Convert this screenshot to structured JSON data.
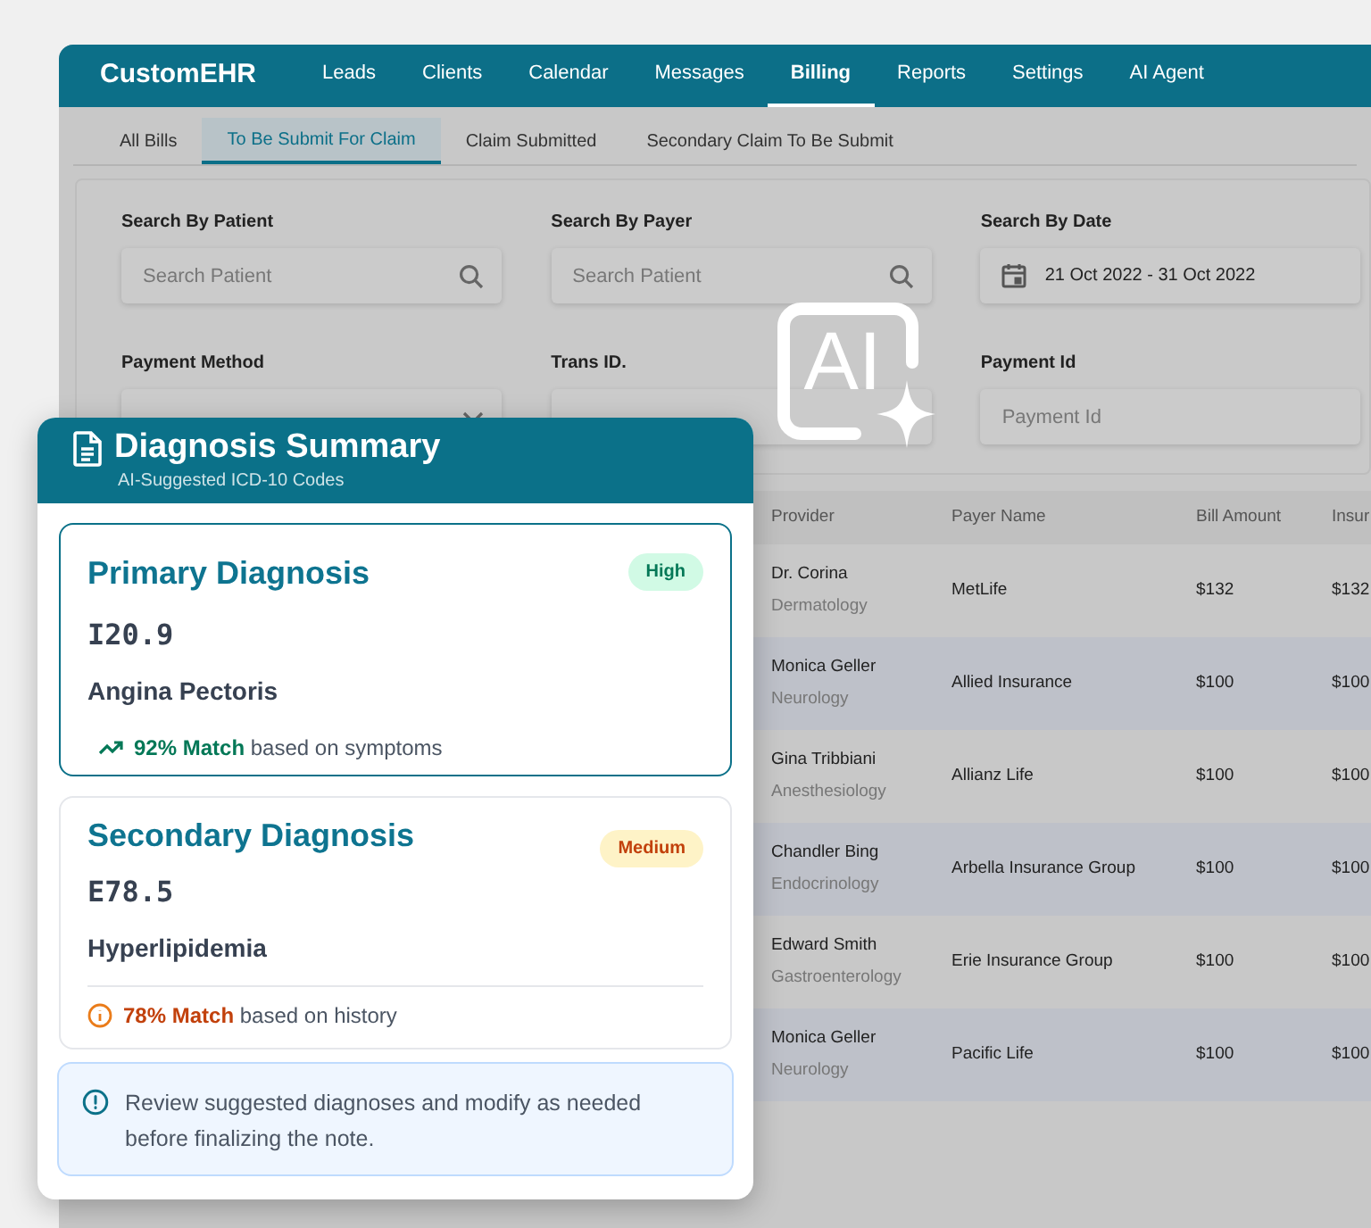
{
  "nav": {
    "brand": "CustomEHR",
    "items": [
      {
        "label": "Leads",
        "selected": false
      },
      {
        "label": "Clients",
        "selected": false
      },
      {
        "label": "Calendar",
        "selected": false
      },
      {
        "label": "Messages",
        "selected": false
      },
      {
        "label": "Billing",
        "selected": true
      },
      {
        "label": "Reports",
        "selected": false
      },
      {
        "label": "Settings",
        "selected": false
      },
      {
        "label": "AI Agent",
        "selected": false
      }
    ]
  },
  "subtabs": [
    {
      "label": "All Bills",
      "selected": false
    },
    {
      "label": "To Be Submit For Claim",
      "selected": true
    },
    {
      "label": "Claim Submitted",
      "selected": false
    },
    {
      "label": "Secondary Claim To Be Submit",
      "selected": false
    }
  ],
  "filters": [
    {
      "label": "Search By Patient",
      "kind": "search",
      "placeholder": "Search Patient"
    },
    {
      "label": "Search By Payer",
      "kind": "search",
      "placeholder": "Search Patient"
    },
    {
      "label": "Search By Date",
      "kind": "date",
      "value": "21 Oct 2022 - 31 Oct 2022"
    },
    {
      "label": "Payment Method",
      "kind": "select"
    },
    {
      "label": "Trans ID.",
      "kind": "text"
    },
    {
      "label": "Payment Id",
      "kind": "text",
      "placeholder": "Payment Id"
    }
  ],
  "ai_badge": {
    "label": "AI"
  },
  "table": {
    "columns": [
      "Provider",
      "Payer Name",
      "Bill Amount",
      "Insur"
    ],
    "rows": [
      {
        "provider": "Dr. Corina",
        "specialty": "Dermatology",
        "payer": "MetLife",
        "bill": "$132",
        "column_4": "$132"
      },
      {
        "provider": "Monica Geller",
        "specialty": "Neurology",
        "payer": "Allied Insurance",
        "bill": "$100",
        "column_4": "$100"
      },
      {
        "provider": "Gina Tribbiani",
        "specialty": "Anesthesiology",
        "payer": "Allianz Life",
        "bill": "$100",
        "column_4": "$100"
      },
      {
        "provider": "Chandler Bing",
        "specialty": "Endocrinology",
        "payer": "Arbella Insurance Group",
        "bill": "$100",
        "column_4": "$100"
      },
      {
        "provider": "Edward Smith",
        "specialty": "Gastroenterology",
        "payer": "Erie Insurance Group",
        "bill": "$100",
        "column_4": "$100"
      },
      {
        "provider": "Monica Geller",
        "specialty": "Neurology",
        "payer": "Pacific Life",
        "bill": "$100",
        "column_4": "$100"
      }
    ]
  },
  "summary": {
    "title": "Diagnosis Summary",
    "subtitle": "AI-Suggested ICD-10 Codes",
    "diagnoses": [
      {
        "heading": "Primary Diagnosis",
        "confidence": {
          "label": "High",
          "kind": "high"
        },
        "highlighted": true,
        "code": "I20.9",
        "name": "Angina Pectoris",
        "match": "92% Match",
        "basis": "based on symptoms",
        "kind": "trend"
      },
      {
        "heading": "Secondary Diagnosis",
        "confidence": {
          "label": "Medium",
          "kind": "medium"
        },
        "highlighted": false,
        "code": "E78.5",
        "name": "Hyperlipidemia",
        "match": "78% Match",
        "basis": "based on history",
        "kind": "info"
      }
    ],
    "note": "Review suggested diagnoses and modify as needed before finalizing the note."
  }
}
